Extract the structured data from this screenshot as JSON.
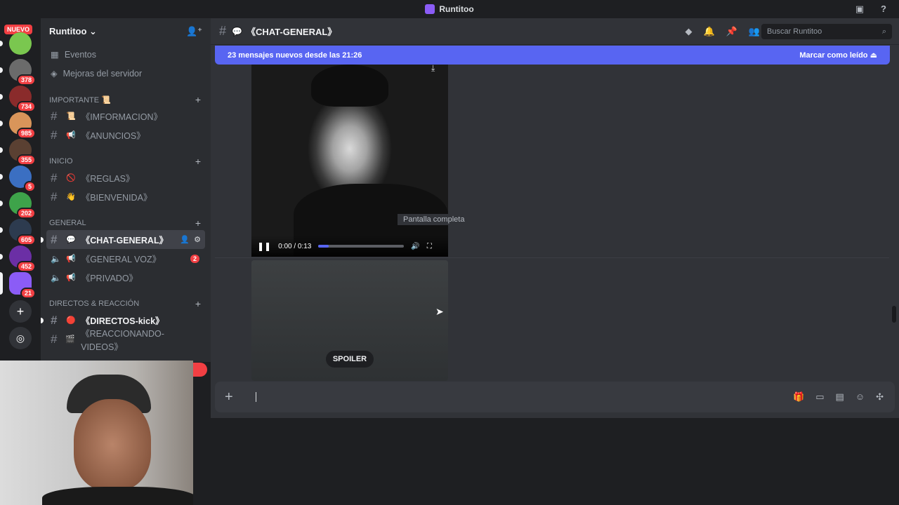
{
  "titlebar": {
    "app_title": "Runtitoo"
  },
  "rail": {
    "nuevo_label": "NUEVO",
    "servers": [
      {
        "name": "server-1",
        "badge": "",
        "color": "#7ac74f"
      },
      {
        "name": "server-2",
        "badge": "378",
        "color": "#6b6b6b"
      },
      {
        "name": "server-3",
        "badge": "734",
        "color": "#8a2b2b"
      },
      {
        "name": "server-4",
        "badge": "985",
        "color": "#d9955a"
      },
      {
        "name": "server-5",
        "badge": "355",
        "color": "#5a4032"
      },
      {
        "name": "server-6",
        "badge": "5",
        "color": "#3b6fc2"
      },
      {
        "name": "server-7",
        "badge": "202",
        "color": "#3ea34a"
      },
      {
        "name": "server-8",
        "badge": "605",
        "color": "#2d3b4f"
      },
      {
        "name": "server-9",
        "badge": "452",
        "color": "#6b2fa5"
      },
      {
        "name": "server-10",
        "badge": "21",
        "color": "#8b5cf6"
      }
    ]
  },
  "sidebar": {
    "server_name": "Runtitoo",
    "links": [
      {
        "label": "Eventos",
        "icon": "calendar-icon"
      },
      {
        "label": "Mejoras del servidor",
        "icon": "boost-icon"
      }
    ],
    "categories": [
      {
        "label": "IMPORTANTE 📜",
        "channels": [
          {
            "emoji": "📜",
            "label": "《IMFORMACION》"
          },
          {
            "emoji": "📢",
            "label": "《ANUNCIOS》"
          }
        ]
      },
      {
        "label": "INICIO",
        "channels": [
          {
            "emoji": "🚫",
            "label": "《REGLAS》"
          },
          {
            "emoji": "👋",
            "label": "《BIENVENIDA》"
          }
        ]
      },
      {
        "label": "GENERAL",
        "channels": [
          {
            "emoji": "💬",
            "label": "《CHAT-GENERAL》",
            "active": true
          },
          {
            "emoji": "📢",
            "label": "《GENERAL VOZ》",
            "voice": true,
            "count": "2"
          },
          {
            "emoji": "📢",
            "label": "《PRIVADO》",
            "voice": true
          }
        ]
      },
      {
        "label": "DIRECTOS & REACCIÓN",
        "channels": [
          {
            "emoji": "🔴",
            "label": "《DIRECTOS-kick》",
            "bold": true
          },
          {
            "emoji": "🎬",
            "label": "《REACCIONANDO-VIDEOS》"
          }
        ]
      }
    ]
  },
  "header": {
    "channel_title": "《CHAT-GENERAL》",
    "search_placeholder": "Buscar Runtitoo"
  },
  "newbar": {
    "text": "23 mensajes nuevos desde las 21:26",
    "action": "Marcar como leído"
  },
  "video": {
    "time": "0:00 / 0:13",
    "progress_fraction": 0.12,
    "tooltip": "Pantalla completa"
  },
  "spoiler": {
    "label": "SPOILER"
  },
  "composer": {
    "placeholder": ""
  },
  "colors": {
    "accent": "#5865f2",
    "danger": "#f23f43"
  }
}
